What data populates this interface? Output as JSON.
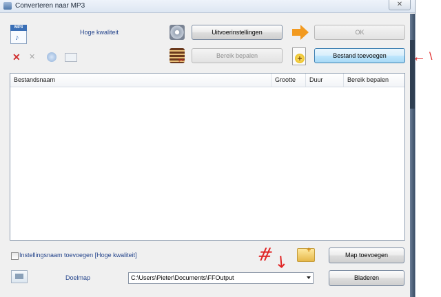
{
  "window": {
    "title": "Converteren naar MP3",
    "close_label": "✕"
  },
  "header": {
    "format_label": "MP3",
    "quality": "Hoge kwaliteit"
  },
  "toolbar": {
    "output_settings_label": "Uitvoerinstellingen",
    "ok_label": "OK",
    "range_label": "Bereik bepalen",
    "add_file_label": "Bestand toevoegen"
  },
  "list": {
    "columns": [
      "Bestandsnaam",
      "Grootte",
      "Duur",
      "Bereik bepalen"
    ],
    "rows": []
  },
  "options": {
    "add_setting_name_label": "Instellingsnaam toevoegen [Hoge kwaliteit]",
    "checked": false
  },
  "destination": {
    "label": "Doelmap",
    "path": "C:\\Users\\Pieter\\Documents\\FFOutput",
    "add_folder_label": "Map toevoegen",
    "browse_label": "Bladeren"
  },
  "annotations": {
    "hash_mark": "#",
    "arrow_glyph": "↘",
    "right_arrow_glyph": "←",
    "right_mark": "\\"
  },
  "colors": {
    "label_blue": "#25458c",
    "annotation_red": "#e02424"
  }
}
